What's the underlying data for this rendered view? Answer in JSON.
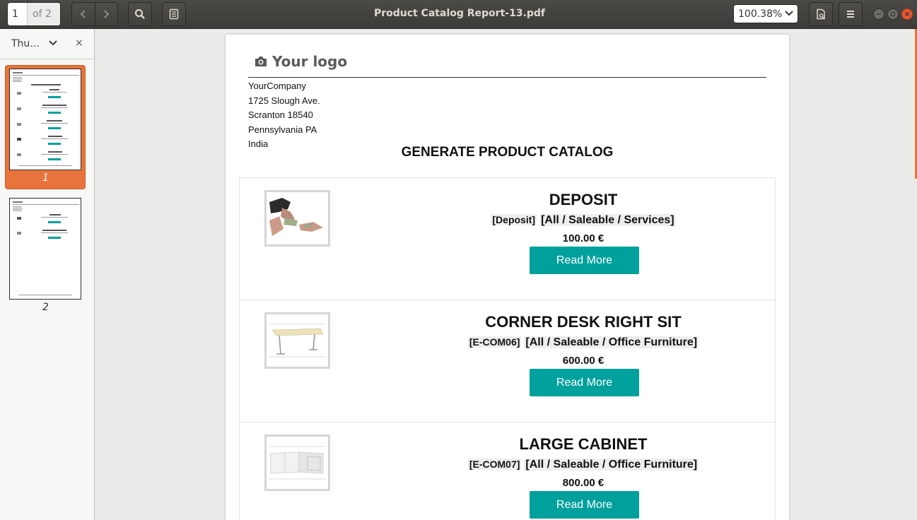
{
  "toolbar": {
    "page_current": "1",
    "page_total": "of 2",
    "title": "Product Catalog Report-13.pdf",
    "zoom": "100.38%"
  },
  "sidebar": {
    "mode_label": "Thu…",
    "close_label": "×",
    "thumbnails": [
      {
        "page": "1",
        "selected": true
      },
      {
        "page": "2",
        "selected": false
      }
    ]
  },
  "document": {
    "logo_text": "Your logo",
    "address": [
      "YourCompany",
      "1725 Slough Ave.",
      "Scranton 18540",
      "Pennsylvania PA",
      "India"
    ],
    "title": "GENERATE PRODUCT CATALOG",
    "products": [
      {
        "name": "DEPOSIT",
        "code": "[Deposit]",
        "category": "[All / Saleable / Services]",
        "price": "100.00 €",
        "button": "Read More"
      },
      {
        "name": "CORNER DESK RIGHT SIT",
        "code": "[E-COM06]",
        "category": "[All / Saleable / Office Furniture]",
        "price": "600.00 €",
        "button": "Read More"
      },
      {
        "name": "LARGE CABINET",
        "code": "[E-COM07]",
        "category": "[All / Saleable / Office Furniture]",
        "price": "800.00 €",
        "button": "Read More"
      }
    ]
  },
  "colors": {
    "accent": "#e8743b",
    "button": "#00a09d",
    "headerbar": "#3c3b37"
  },
  "icons": [
    "search-icon",
    "annotations-icon",
    "chevron-left-icon",
    "chevron-right-icon",
    "chevron-down-icon",
    "document-properties-icon",
    "hamburger-menu-icon",
    "camera-icon"
  ]
}
